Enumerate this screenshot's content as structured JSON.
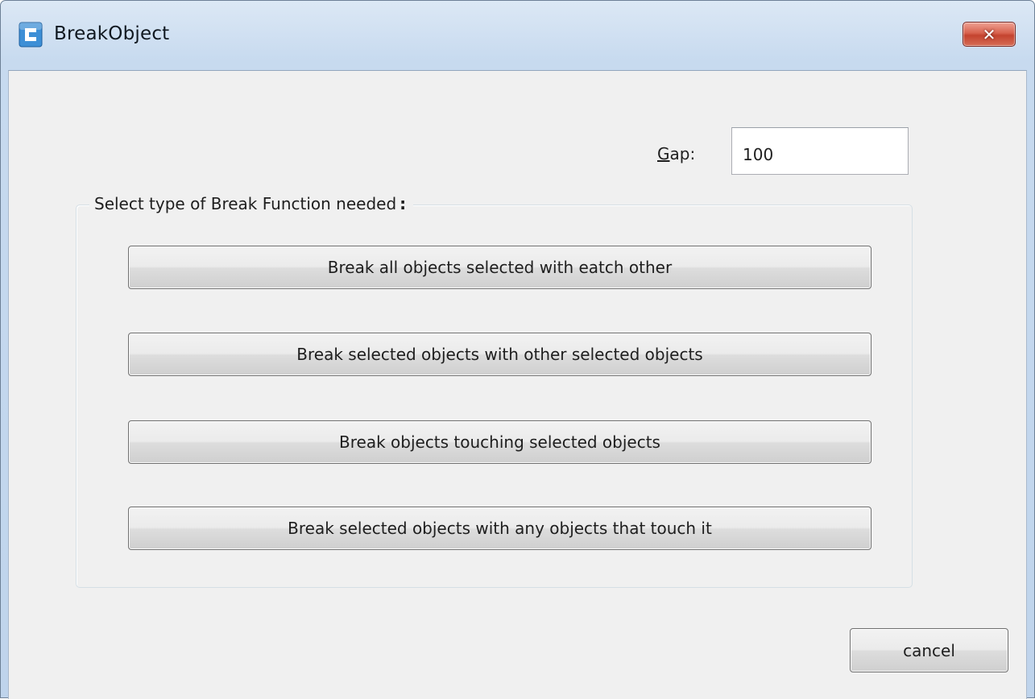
{
  "window": {
    "title": "BreakObject",
    "app_icon": "app-logo-icon",
    "close_icon": "close-icon",
    "close_glyph": "✕",
    "accent_color": "#c4432f"
  },
  "gap": {
    "label_mnemonic": "G",
    "label_rest": "ap:",
    "value": "100"
  },
  "group": {
    "title": "Select type of Break Function needed",
    "title_suffix": ":"
  },
  "buttons": [
    {
      "label": "Break all objects selected with eatch other"
    },
    {
      "label": "Break selected objects with other selected objects"
    },
    {
      "label": "Break objects touching selected objects"
    },
    {
      "label": "Break selected objects with any objects that touch it"
    }
  ],
  "footer": {
    "cancel_label": "cancel"
  }
}
